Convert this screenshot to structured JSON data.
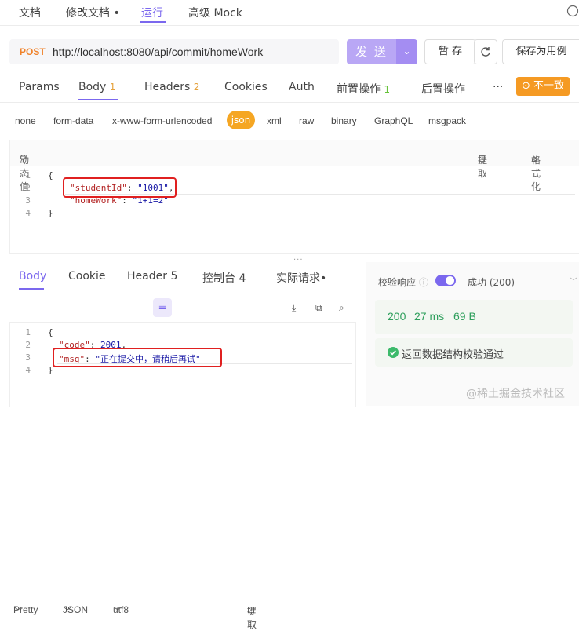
{
  "top_tabs": {
    "doc": "文档",
    "edit_doc": "修改文档",
    "edit_dot": "•",
    "run": "运行",
    "advanced_mock": "高级 Mock"
  },
  "request": {
    "method": "POST",
    "url": "http://localhost:8080/api/commit/homeWork",
    "send_label": "发 送",
    "save_label": "暂 存",
    "save_as_case_label": "保存为用例"
  },
  "req_tabs": [
    {
      "label": "Params",
      "count": ""
    },
    {
      "label": "Body",
      "count": "1"
    },
    {
      "label": "Headers",
      "count": "2"
    },
    {
      "label": "Cookies",
      "count": ""
    },
    {
      "label": "Auth",
      "count": ""
    },
    {
      "label": "前置操作",
      "count": "1"
    },
    {
      "label": "后置操作",
      "count": ""
    }
  ],
  "more_label": "···",
  "mismatch_label": "不一致",
  "body_types": [
    "none",
    "form-data",
    "x-www-form-urlencoded",
    "json",
    "xml",
    "raw",
    "binary",
    "GraphQL",
    "msgpack"
  ],
  "editor_tools": {
    "dynamic_value": "动态值",
    "extract": "提取",
    "format": "格式化"
  },
  "request_body": {
    "lines": [
      "1",
      "2",
      "3",
      "4"
    ],
    "l1": "{",
    "l2_key": "\"studentId\"",
    "l2_sep": ": ",
    "l2_val": "\"1001\"",
    "l2_end": ",",
    "l3_key": "\"homeWork\"",
    "l3_sep": ": ",
    "l3_val": "\"1+1=2\"",
    "l4": "}"
  },
  "resizer": "···",
  "resp_tabs": [
    {
      "label": "Body",
      "count": ""
    },
    {
      "label": "Cookie",
      "count": ""
    },
    {
      "label": "Header",
      "count": "5"
    },
    {
      "label": "控制台",
      "count": "4"
    },
    {
      "label": "实际请求",
      "count": "•"
    }
  ],
  "resp_format": {
    "pretty": "Pretty",
    "json": "JSON",
    "encoding": "utf8",
    "extract": "提取"
  },
  "response_body": {
    "lines": [
      "1",
      "2",
      "3",
      "4"
    ],
    "l1": "{",
    "l2_key": "\"code\"",
    "l2_sep": ": ",
    "l2_val": "2001",
    "l2_end": ",",
    "l3_key": "\"msg\"",
    "l3_sep": ": ",
    "l3_val": "\"正在提交中，请稍后再试\"",
    "l4": "}"
  },
  "validation": {
    "label": "校验响应",
    "success": "成功 (200)",
    "status": "200",
    "time": "27 ms",
    "size": "69 B",
    "ok_message": "返回数据结构校验通过"
  },
  "watermark": "@稀土掘金技术社区"
}
